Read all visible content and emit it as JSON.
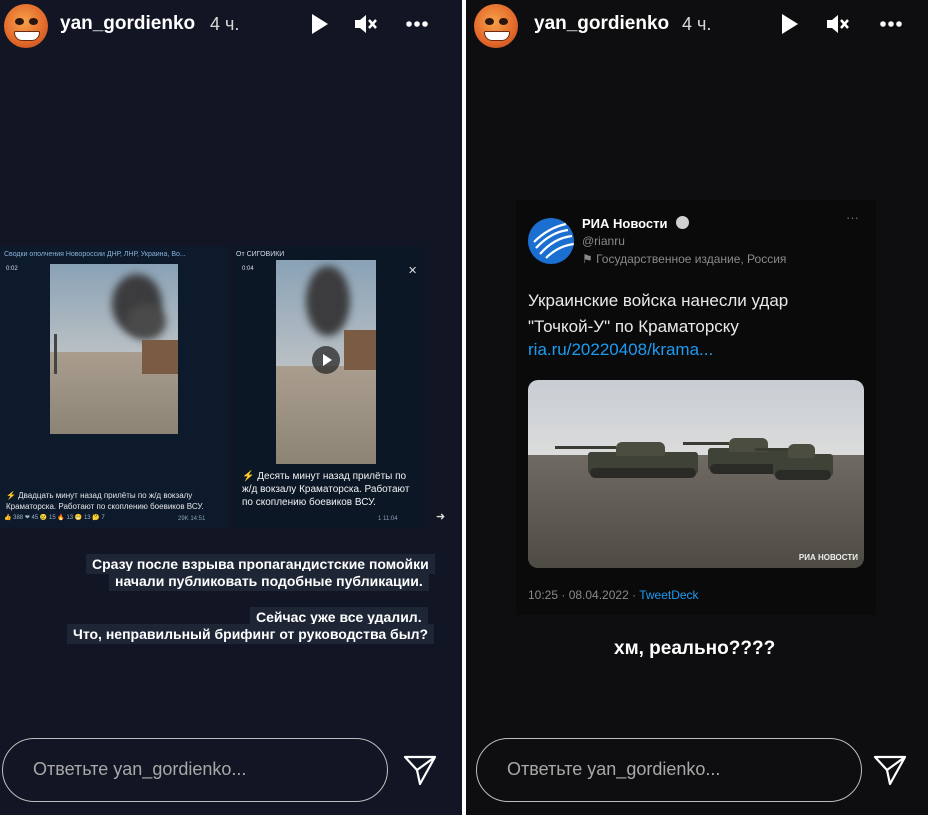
{
  "left_story": {
    "username": "yan_gordienko",
    "time": "4 ч.",
    "reply_placeholder": "Ответьте yan_gordienko...",
    "embedded": {
      "card1": {
        "header": "Сводки ополчения Новороссии ДНР, ЛНР, Украина, Во...",
        "duration": "0:02",
        "caption": "⚡ Двадцать минут назад прилёты по ж/д вокзалу Краматорска. Работают по скоплению боевиков ВСУ.",
        "reactions": "👍 388  ❤ 45  😢 15  🔥 13  😁 13  🤔 7",
        "views": "29K  14:51"
      },
      "card2": {
        "header": "От СИГОВИКИ",
        "duration": "0:04",
        "caption": "⚡ Десять минут назад прилёты по ж/д вокзалу Краматорска. Работают по скоплению боевиков ВСУ.",
        "views": "1  11:04"
      }
    },
    "text_lines": [
      "Сразу после взрыва пропагандистские помойки",
      "начали публиковать подобные публикации.",
      "Сейчас уже все удалил.",
      "Что, неправильный брифинг от руководства был?"
    ]
  },
  "right_story": {
    "username": "yan_gordienko",
    "time": "4 ч.",
    "reply_placeholder": "Ответьте yan_gordienko...",
    "tweet": {
      "name": "РИА Новости",
      "handle": "@rianru",
      "label": "Государственное издание, Россия",
      "text": "Украинские войска нанесли удар \"Точкой-У\" по Краматорску",
      "link": "ria.ru/20220408/krama...",
      "watermark": "РИА НОВОСТИ",
      "timestamp": "10:25 · 08.04.2022 · ",
      "client": "TweetDeck"
    },
    "caption": "хм, реально????"
  },
  "icons": {
    "play": "play-icon",
    "mute": "mute-icon",
    "more": "more-icon",
    "send": "send-icon"
  }
}
